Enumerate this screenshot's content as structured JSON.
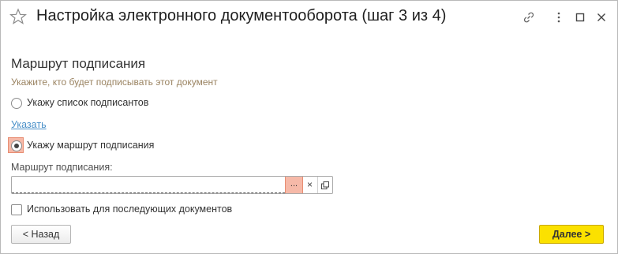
{
  "window": {
    "title": "Настройка электронного документооборота (шаг 3 из 4)",
    "controls": {
      "link_icon": "link-icon",
      "more_icon": "more-icon",
      "maximize_icon": "maximize-icon",
      "close_icon": "close-icon"
    }
  },
  "section": {
    "title": "Маршрут подписания",
    "hint": "Укажите, кто будет подписывать этот документ"
  },
  "options": {
    "signers_list_label": "Укажу список подписантов",
    "specify_link": "Указать",
    "route_label": "Укажу маршрут подписания",
    "selected": "route"
  },
  "route_field": {
    "label": "Маршрут подписания:",
    "value": "",
    "select_button": "...",
    "clear_button": "×"
  },
  "reuse_checkbox": {
    "label": "Использовать для последующих документов",
    "checked": false
  },
  "buttons": {
    "back": "< Назад",
    "next": "Далее >"
  },
  "colors": {
    "accent_yellow": "#fbe100",
    "focus_highlight": "#f6b9a8",
    "hint_text": "#9a8361",
    "link": "#4a90c8"
  }
}
